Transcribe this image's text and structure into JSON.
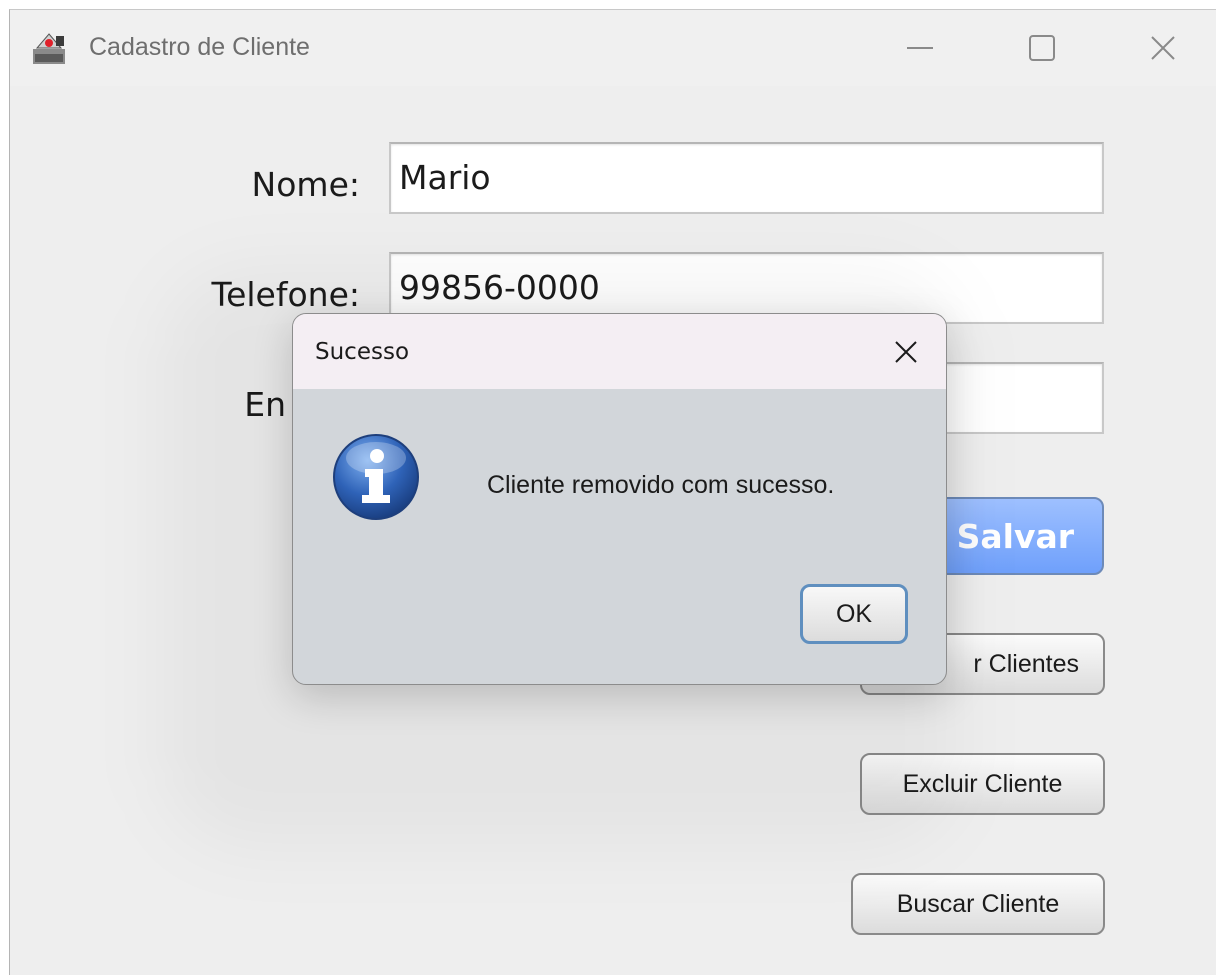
{
  "window": {
    "title": "Cadastro de Cliente"
  },
  "form": {
    "nome": {
      "label": "Nome:",
      "value": "Mario"
    },
    "telefone": {
      "label": "Telefone:",
      "value": "99856-0000"
    },
    "email": {
      "label_visible": "En",
      "value": ""
    }
  },
  "buttons": {
    "salvar": "Salvar",
    "listar_visible": "r Clientes",
    "excluir": "Excluir Cliente",
    "buscar": "Buscar Cliente"
  },
  "dialog": {
    "title": "Sucesso",
    "message": "Cliente removido com sucesso.",
    "ok_label": "OK",
    "icon": "information-icon"
  },
  "colors": {
    "save_button": "#7fa9ff",
    "info_icon": "#2f63b8",
    "ok_border": "#5f8fbf"
  }
}
